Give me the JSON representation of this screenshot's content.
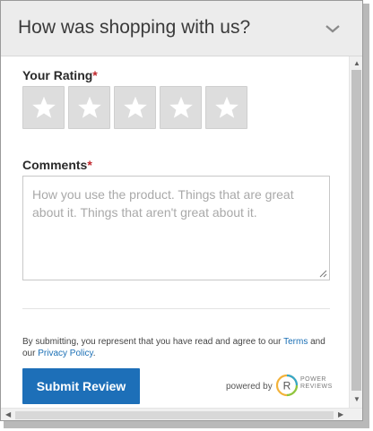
{
  "header": {
    "title": "How was shopping with us?"
  },
  "rating": {
    "label": "Your Rating",
    "required_mark": "*",
    "stars": 5
  },
  "comments": {
    "label": "Comments",
    "required_mark": "*",
    "placeholder": "How you use the product. Things that are great about it. Things that aren't great about it."
  },
  "disclaimer": {
    "prefix": "By submitting, you represent that you have read and agree to our ",
    "terms": "Terms",
    "middle": " and our ",
    "privacy": "Privacy Policy",
    "suffix": "."
  },
  "submit_label": "Submit Review",
  "powered_by": {
    "text": "powered by",
    "brand_line1": "POWER",
    "brand_line2": "REVIEWS",
    "brand_letter": "R"
  },
  "colors": {
    "header_bg": "#ececec",
    "submit_bg": "#1d6fb8",
    "link": "#1a6fb5",
    "required": "#c0282d",
    "star_bg": "#dddddd"
  }
}
